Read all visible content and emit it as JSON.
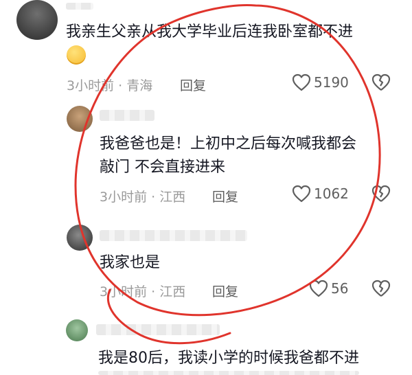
{
  "comments": [
    {
      "text_lines": [
        "我亲生父亲从我大学毕业后连我卧室都不进"
      ],
      "emoji": "worried-face-emoji",
      "meta": "3小时前 · 青海",
      "reply_label": "回复",
      "likes": "5190"
    },
    {
      "text_lines": [
        "我爸爸也是！上初中之后每次喊我都会",
        "敲门 不会直接进来"
      ],
      "meta": "3小时前 · 江西",
      "reply_label": "回复",
      "likes": "1062"
    },
    {
      "text_lines": [
        "我家也是"
      ],
      "meta": "3小时前 · 江西",
      "reply_label": "回复",
      "likes": "56"
    },
    {
      "text_lines": [
        "我是80后，我读小学的时候我爸都不进"
      ]
    }
  ],
  "icons": {
    "like": "heart-outline-icon",
    "dislike": "broken-heart-icon"
  },
  "colors": {
    "annotation": "#e0342c",
    "meta_text": "#9a9a9a",
    "body_text": "#161823"
  }
}
